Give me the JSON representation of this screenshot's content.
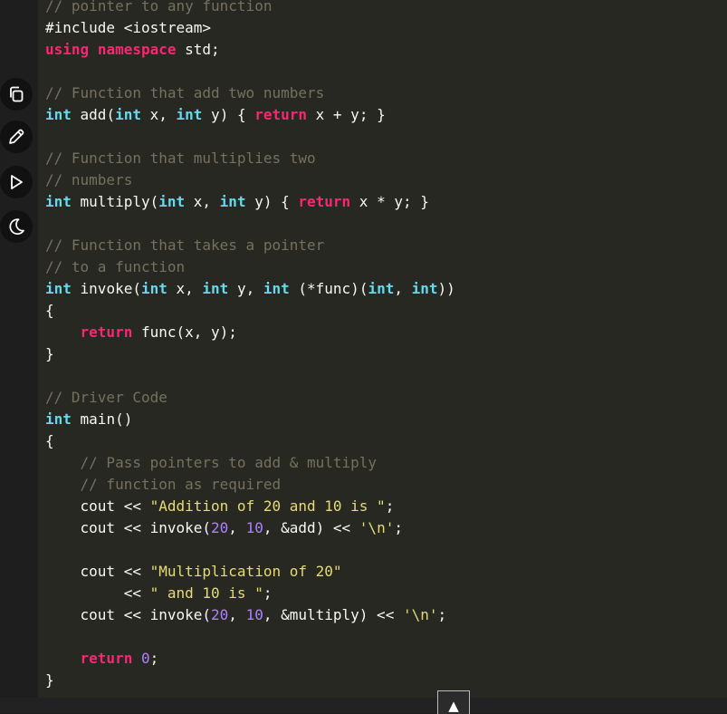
{
  "editor": {
    "lines": [
      [
        {
          "t": "// pointer to any function",
          "c": "comment"
        }
      ],
      [
        {
          "t": "#include <iostream>",
          "c": "plain"
        }
      ],
      [
        {
          "t": "using",
          "c": "keyword"
        },
        {
          "t": " ",
          "c": "plain"
        },
        {
          "t": "namespace",
          "c": "keyword"
        },
        {
          "t": " std;",
          "c": "plain"
        }
      ],
      [
        {
          "t": "",
          "c": "plain"
        }
      ],
      [
        {
          "t": "// Function that add two numbers",
          "c": "comment"
        }
      ],
      [
        {
          "t": "int",
          "c": "type"
        },
        {
          "t": " add(",
          "c": "plain"
        },
        {
          "t": "int",
          "c": "type"
        },
        {
          "t": " x, ",
          "c": "plain"
        },
        {
          "t": "int",
          "c": "type"
        },
        {
          "t": " y) { ",
          "c": "plain"
        },
        {
          "t": "return",
          "c": "keyword"
        },
        {
          "t": " x + y; }",
          "c": "plain"
        }
      ],
      [
        {
          "t": "",
          "c": "plain"
        }
      ],
      [
        {
          "t": "// Function that multiplies two",
          "c": "comment"
        }
      ],
      [
        {
          "t": "// numbers",
          "c": "comment"
        }
      ],
      [
        {
          "t": "int",
          "c": "type"
        },
        {
          "t": " multiply(",
          "c": "plain"
        },
        {
          "t": "int",
          "c": "type"
        },
        {
          "t": " x, ",
          "c": "plain"
        },
        {
          "t": "int",
          "c": "type"
        },
        {
          "t": " y) { ",
          "c": "plain"
        },
        {
          "t": "return",
          "c": "keyword"
        },
        {
          "t": " x * y; }",
          "c": "plain"
        }
      ],
      [
        {
          "t": "",
          "c": "plain"
        }
      ],
      [
        {
          "t": "// Function that takes a pointer",
          "c": "comment"
        }
      ],
      [
        {
          "t": "// to a function",
          "c": "comment"
        }
      ],
      [
        {
          "t": "int",
          "c": "type"
        },
        {
          "t": " invoke(",
          "c": "plain"
        },
        {
          "t": "int",
          "c": "type"
        },
        {
          "t": " x, ",
          "c": "plain"
        },
        {
          "t": "int",
          "c": "type"
        },
        {
          "t": " y, ",
          "c": "plain"
        },
        {
          "t": "int",
          "c": "type"
        },
        {
          "t": " (*func)(",
          "c": "plain"
        },
        {
          "t": "int",
          "c": "type"
        },
        {
          "t": ", ",
          "c": "plain"
        },
        {
          "t": "int",
          "c": "type"
        },
        {
          "t": "))",
          "c": "plain"
        }
      ],
      [
        {
          "t": "{",
          "c": "plain"
        }
      ],
      [
        {
          "t": "    ",
          "c": "plain"
        },
        {
          "t": "return",
          "c": "keyword"
        },
        {
          "t": " func(x, y);",
          "c": "plain"
        }
      ],
      [
        {
          "t": "}",
          "c": "plain"
        }
      ],
      [
        {
          "t": "",
          "c": "plain"
        }
      ],
      [
        {
          "t": "// Driver Code",
          "c": "comment"
        }
      ],
      [
        {
          "t": "int",
          "c": "type"
        },
        {
          "t": " main()",
          "c": "plain"
        }
      ],
      [
        {
          "t": "{",
          "c": "plain"
        }
      ],
      [
        {
          "t": "    // Pass pointers to add & multiply",
          "c": "comment"
        }
      ],
      [
        {
          "t": "    // function as required",
          "c": "comment"
        }
      ],
      [
        {
          "t": "    cout << ",
          "c": "plain"
        },
        {
          "t": "\"Addition of 20 and 10 is \"",
          "c": "string"
        },
        {
          "t": ";",
          "c": "plain"
        }
      ],
      [
        {
          "t": "    cout << invoke(",
          "c": "plain"
        },
        {
          "t": "20",
          "c": "number"
        },
        {
          "t": ", ",
          "c": "plain"
        },
        {
          "t": "10",
          "c": "number"
        },
        {
          "t": ", &add) << ",
          "c": "plain"
        },
        {
          "t": "'\\n'",
          "c": "string"
        },
        {
          "t": ";",
          "c": "plain"
        }
      ],
      [
        {
          "t": "",
          "c": "plain"
        }
      ],
      [
        {
          "t": "    cout << ",
          "c": "plain"
        },
        {
          "t": "\"Multiplication of 20\"",
          "c": "string"
        }
      ],
      [
        {
          "t": "         << ",
          "c": "plain"
        },
        {
          "t": "\" and 10 is \"",
          "c": "string"
        },
        {
          "t": ";",
          "c": "plain"
        }
      ],
      [
        {
          "t": "    cout << invoke(",
          "c": "plain"
        },
        {
          "t": "20",
          "c": "number"
        },
        {
          "t": ", ",
          "c": "plain"
        },
        {
          "t": "10",
          "c": "number"
        },
        {
          "t": ", &multiply) << ",
          "c": "plain"
        },
        {
          "t": "'\\n'",
          "c": "string"
        },
        {
          "t": ";",
          "c": "plain"
        }
      ],
      [
        {
          "t": "",
          "c": "plain"
        }
      ],
      [
        {
          "t": "    ",
          "c": "plain"
        },
        {
          "t": "return",
          "c": "keyword"
        },
        {
          "t": " ",
          "c": "plain"
        },
        {
          "t": "0",
          "c": "number"
        },
        {
          "t": ";",
          "c": "plain"
        }
      ],
      [
        {
          "t": "}",
          "c": "plain"
        }
      ]
    ]
  },
  "toolbar": {
    "buttons": [
      {
        "name": "copy-button",
        "icon": "copy-icon"
      },
      {
        "name": "edit-button",
        "icon": "pencil-icon"
      },
      {
        "name": "run-button",
        "icon": "play-icon"
      },
      {
        "name": "theme-toggle-button",
        "icon": "moon-icon"
      }
    ]
  },
  "scroll_top": {
    "label": "▲",
    "icon": "arrow-up-icon"
  },
  "colors": {
    "background": "#272822",
    "comment": "#75715e",
    "keyword": "#f92672",
    "type": "#66d9ef",
    "string": "#e6db74",
    "number": "#ae81ff",
    "text": "#f8f8f2"
  }
}
